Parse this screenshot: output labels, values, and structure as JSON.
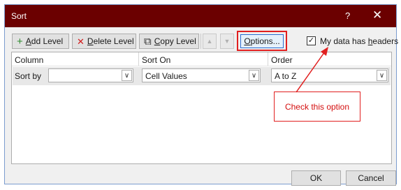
{
  "window": {
    "title": "Sort",
    "help_glyph": "?",
    "close_glyph": "✕"
  },
  "toolbar": {
    "add_level": {
      "icon": "plus-icon",
      "glyph": "+",
      "label_pre": "",
      "label_ul": "A",
      "label_post": "dd Level"
    },
    "delete_level": {
      "icon": "x-icon",
      "glyph": "✕",
      "label_pre": "",
      "label_ul": "D",
      "label_post": "elete Level"
    },
    "copy_level": {
      "icon": "copy-icon",
      "glyph": "⧉",
      "label_pre": "",
      "label_ul": "C",
      "label_post": "opy Level"
    },
    "move_up_glyph": "▲",
    "move_down_glyph": "▼",
    "options": {
      "label_pre": "",
      "label_ul": "O",
      "label_post": "ptions..."
    },
    "headers_checkbox": {
      "checked": true,
      "mark": "✓",
      "label_pre": "My data has ",
      "label_ul": "h",
      "label_post": "eaders"
    }
  },
  "grid": {
    "headers": [
      "Column",
      "Sort On",
      "Order"
    ],
    "row": {
      "label": "Sort by",
      "column_value": "",
      "sort_on_value": "Cell Values",
      "order_value": "A to Z"
    },
    "dropdown_glyph": "∨"
  },
  "annotation": {
    "text": "Check this option",
    "color": "#e11f1f"
  },
  "footer": {
    "ok": "OK",
    "cancel": "Cancel"
  },
  "colors": {
    "titlebar": "#6b0000",
    "accent_border": "#2a6bd0",
    "highlight": "#e11f1f"
  }
}
